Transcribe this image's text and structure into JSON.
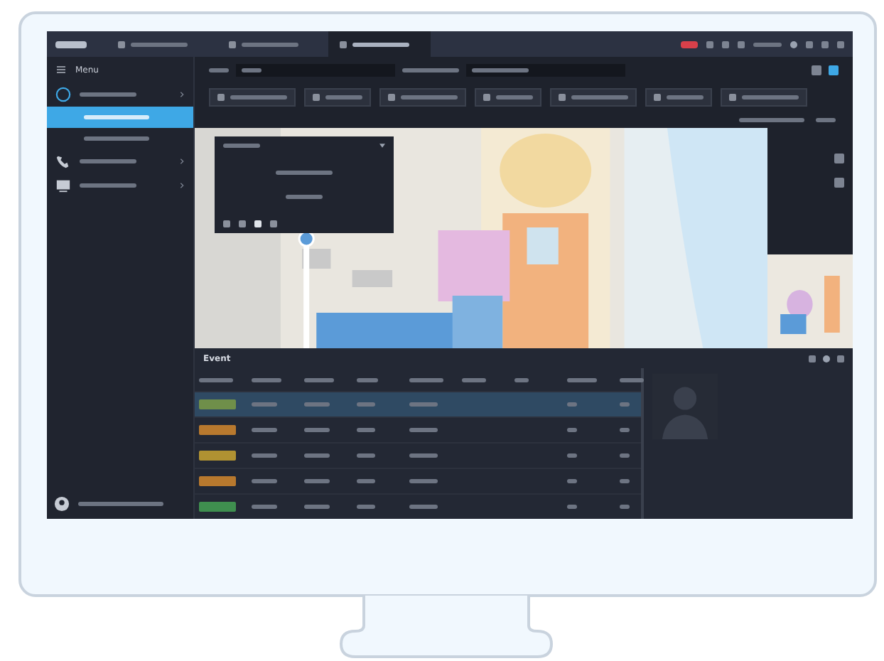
{
  "tabs": [
    {
      "selected": false
    },
    {
      "selected": false
    },
    {
      "selected": true
    }
  ],
  "sidebar": {
    "title": "Menu",
    "items": [
      {
        "kind": "group",
        "selected": false
      },
      {
        "kind": "sub",
        "selected": true
      },
      {
        "kind": "sub",
        "selected": false
      },
      {
        "kind": "phone",
        "selected": false
      },
      {
        "kind": "monitor",
        "selected": false
      }
    ]
  },
  "events": {
    "title": "Event",
    "rows": [
      {
        "color": "#6f8f4a",
        "selected": true
      },
      {
        "color": "#b8792e",
        "selected": false
      },
      {
        "color": "#b09232",
        "selected": false
      },
      {
        "color": "#b8792e",
        "selected": false
      },
      {
        "color": "#3f8f4f",
        "selected": false
      }
    ]
  }
}
